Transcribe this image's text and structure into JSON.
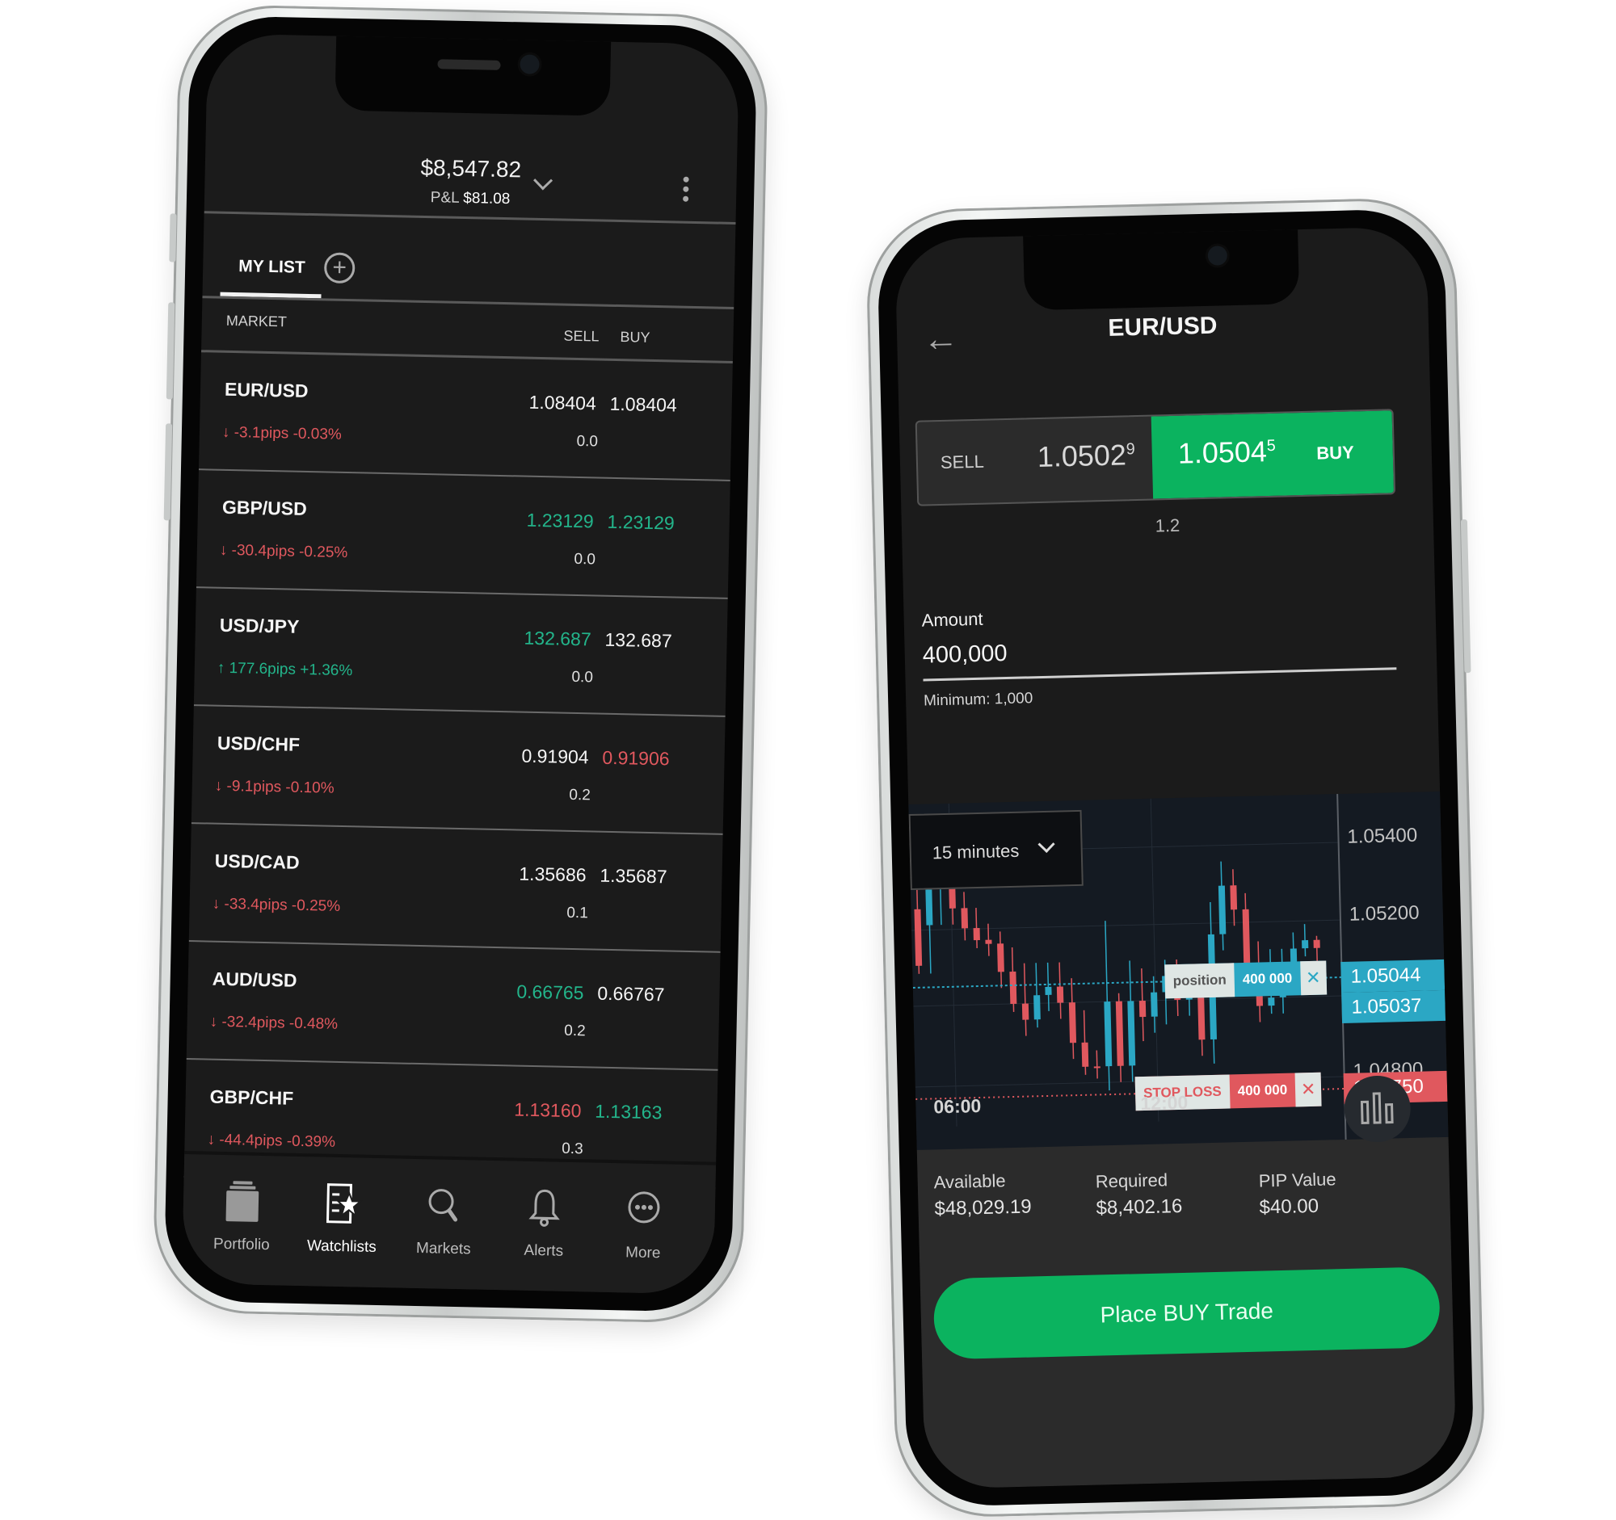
{
  "watchlist_screen": {
    "balance": "$8,547.82",
    "pnl_label": "P&L",
    "pnl_value": "$81.08",
    "tab_label": "MY LIST",
    "columns": {
      "market": "MARKET",
      "sell": "SELL",
      "buy": "BUY"
    },
    "rows": [
      {
        "symbol": "EUR/USD",
        "direction": "down",
        "pips": "-3.1pips",
        "pct": "-0.03%",
        "sell": "1.08404",
        "sell_color": "white",
        "buy": "1.08404",
        "buy_color": "white",
        "spread": "0.0"
      },
      {
        "symbol": "GBP/USD",
        "direction": "down",
        "pips": "-30.4pips",
        "pct": "-0.25%",
        "sell": "1.23129",
        "sell_color": "green",
        "buy": "1.23129",
        "buy_color": "green",
        "spread": "0.0"
      },
      {
        "symbol": "USD/JPY",
        "direction": "up",
        "pips": "177.6pips",
        "pct": "+1.36%",
        "sell": "132.687",
        "sell_color": "green",
        "buy": "132.687",
        "buy_color": "white",
        "spread": "0.0"
      },
      {
        "symbol": "USD/CHF",
        "direction": "down",
        "pips": "-9.1pips",
        "pct": "-0.10%",
        "sell": "0.91904",
        "sell_color": "white",
        "buy": "0.91906",
        "buy_color": "red",
        "spread": "0.2"
      },
      {
        "symbol": "USD/CAD",
        "direction": "down",
        "pips": "-33.4pips",
        "pct": "-0.25%",
        "sell": "1.35686",
        "sell_color": "white",
        "buy": "1.35687",
        "buy_color": "white",
        "spread": "0.1"
      },
      {
        "symbol": "AUD/USD",
        "direction": "down",
        "pips": "-32.4pips",
        "pct": "-0.48%",
        "sell": "0.66765",
        "sell_color": "green",
        "buy": "0.66767",
        "buy_color": "white",
        "spread": "0.2"
      },
      {
        "symbol": "GBP/CHF",
        "direction": "down",
        "pips": "-44.4pips",
        "pct": "-0.39%",
        "sell": "1.13160",
        "sell_color": "red",
        "buy": "1.13163",
        "buy_color": "green",
        "spread": "0.3"
      }
    ],
    "tabbar": [
      {
        "label": "Portfolio",
        "icon": "portfolio-icon",
        "active": false
      },
      {
        "label": "Watchlists",
        "icon": "watchlist-star-icon",
        "active": true
      },
      {
        "label": "Markets",
        "icon": "search-icon",
        "active": false
      },
      {
        "label": "Alerts",
        "icon": "bell-icon",
        "active": false
      },
      {
        "label": "More",
        "icon": "more-circle-icon",
        "active": false
      }
    ]
  },
  "trade_screen": {
    "title": "EUR/USD",
    "sell_label": "SELL",
    "sell_price_main": "1.0502",
    "sell_price_pip": "9",
    "buy_price_main": "1.0504",
    "buy_price_pip": "5",
    "buy_label": "BUY",
    "spread": "1.2",
    "amount_label": "Amount",
    "amount_value": "400,000",
    "minimum": "Minimum: 1,000",
    "chart": {
      "interval": "15 minutes",
      "y_labels": [
        "1.05400",
        "1.05200",
        "1.04800"
      ],
      "x_labels": [
        "06:00",
        "12:00"
      ],
      "current_bid": "1.05037",
      "position_price": "1.05044",
      "position_tag": {
        "label": "position",
        "amount": "400 000"
      },
      "stop_loss_price": "1.04750",
      "stop_loss_tag": {
        "label": "STOP LOSS",
        "amount": "400 000"
      }
    },
    "available_label": "Available",
    "available_value": "$48,029.19",
    "required_label": "Required",
    "required_value": "$8,402.16",
    "pip_label": "PIP Value",
    "pip_value": "$40.00",
    "place_button": "Place BUY Trade",
    "colors": {
      "buy_green": "#0bb35f",
      "up_teal": "#2ba7c4",
      "down_red": "#e0585e",
      "stop_red": "#e0585e"
    }
  }
}
